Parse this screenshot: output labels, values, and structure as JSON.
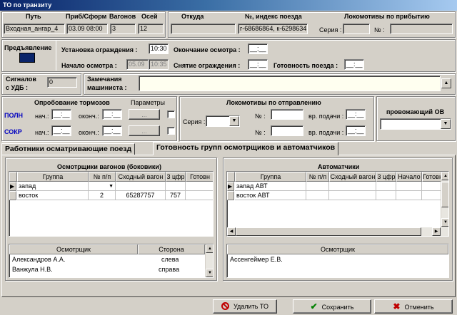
{
  "window": {
    "title": "ТО по транзиту"
  },
  "route": {
    "path_label": "Путь",
    "arrival_label": "Приб/Сформ",
    "wagons_label": "Вагонов",
    "axles_label": "Осей",
    "from_label": "Откуда",
    "train_index_label": "№, индекс поезда",
    "locos_arrival_label": "Локомотивы по прибытию",
    "path_value": "Входная_ангар_4",
    "arrival_value": "03.09 08:00",
    "wagons_value": "3",
    "axles_value": "12",
    "from_value": "",
    "train_index_value": "г-68686864, к-6298634",
    "series_label": "Серия :",
    "series_value": "",
    "number_label": "№ :",
    "number_value": ""
  },
  "presentation": {
    "label": "Предъявление",
    "value": ""
  },
  "times": {
    "fence_install_label": "Установка ограждения :",
    "fence_install_value": "10:30",
    "inspection_start_label": "Начало осмотра :",
    "inspection_start_date": "05.09",
    "inspection_start_time": "10:35",
    "inspection_end_label": "Окончание осмотра :",
    "inspection_end_value": "__:__",
    "fence_remove_label": "Снятие ограждения :",
    "fence_remove_value": "__:__",
    "train_ready_label": "Готовность поезда :",
    "train_ready_value": "__:__"
  },
  "signals": {
    "label_line1": "Сигналов",
    "label_line2": "с УДБ :",
    "value": "0"
  },
  "driver_remarks": {
    "label_line1": "Замечания",
    "label_line2": "машиниста :",
    "value": ""
  },
  "brakes": {
    "title": "Опробование тормозов",
    "params_label": "Параметры",
    "full_label": "ПОЛН",
    "short_label": "СОКР",
    "start_label": "нач.:",
    "end_label": "оконч.:",
    "full_start": "__:__",
    "full_end": "__:__",
    "short_start": "__:__",
    "short_end": "__:__",
    "params_button": "..."
  },
  "locos_departure": {
    "title": "Локомотивы по отправлению",
    "series_label": "Серия :",
    "number_label": "№ :",
    "supply_time_label": "вр. подачи :",
    "supply_time_1": "__:__",
    "supply_time_2": "__:__"
  },
  "escort": {
    "title": "провожающий ОВ",
    "value": ""
  },
  "tabs": [
    {
      "label": "Работники осматривающие поезд"
    },
    {
      "label": "Готовность групп осмотрщиков и автоматчиков"
    }
  ],
  "side_inspectors": {
    "title": "Осмотрщики вагонов (боковики)",
    "columns": [
      "Группа",
      "№ п/п",
      "Сходный вагон",
      "3 цфр",
      "Готовн"
    ],
    "rows": [
      [
        "запад",
        "",
        "",
        "",
        ""
      ],
      [
        "восток",
        "2",
        "65287757",
        "757",
        ""
      ]
    ],
    "people_columns": [
      "Осмотрщик",
      "Сторона"
    ],
    "people": [
      [
        "Александров А.А.",
        "слева"
      ],
      [
        "Ванжула Н.В.",
        "справа"
      ]
    ]
  },
  "automatics": {
    "title": "Автоматчики",
    "columns": [
      "Группа",
      "№ п/п",
      "Сходный вагон",
      "3 цфр",
      "Начало",
      "Готовн"
    ],
    "rows": [
      [
        "запад АВТ",
        "",
        "",
        "",
        "",
        ""
      ],
      [
        "восток АВТ",
        "",
        "",
        "",
        "",
        ""
      ]
    ],
    "people_columns": [
      "Осмотрщик"
    ],
    "people": [
      [
        "Ассенгеймер Е.В."
      ]
    ]
  },
  "footer": {
    "delete_label": "Удалить ТО",
    "save_label": "Сохранить",
    "cancel_label": "Отменить"
  },
  "colors": {
    "face": "#d4d0c8",
    "title_bar": "#0a246a",
    "brake_label": "#0000c0",
    "save_check": "#008000",
    "cancel_x": "#c00000",
    "delete_icon": "#c00000"
  }
}
